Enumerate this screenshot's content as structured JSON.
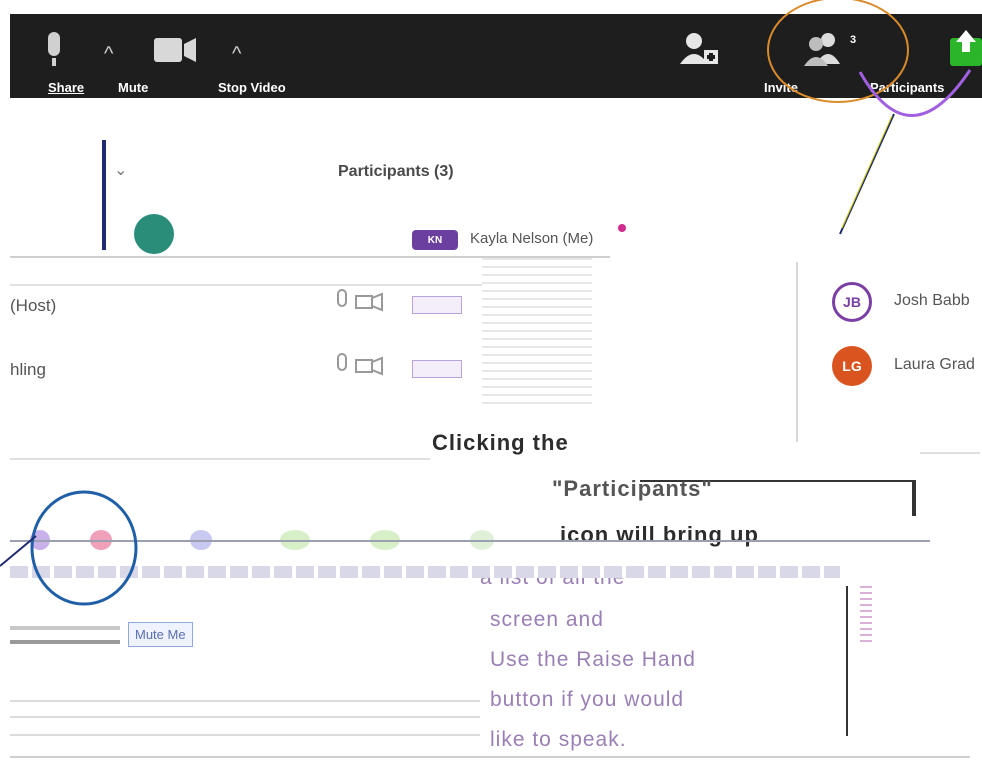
{
  "toolbar": {
    "share_label": "Share",
    "mute_label": "Mute",
    "stop_video_label": "Stop Video",
    "invite_label": "Invite",
    "participants_label": "Participants",
    "participants_count": "3"
  },
  "panel": {
    "title": "Participants (3)",
    "participants": [
      {
        "name": "Kayla Nelson (Me)",
        "initials": "KN",
        "color": "#6b3fa0"
      },
      {
        "name": "Josh Babb",
        "initials": "JB",
        "color": "#7a3fa3"
      },
      {
        "name": "Laura Grad",
        "initials": "LG",
        "color": "#d9541f"
      }
    ],
    "host_fragment": "(Host)",
    "row3_fragment": "hling",
    "mute_me_label": "Mute Me"
  },
  "annotation": {
    "line1": "Clicking the",
    "line2": "\"Participants\"",
    "line3": "icon will bring up",
    "line4": "a list of all the",
    "line5": "screen and",
    "line6": "Use the Raise Hand",
    "line7": "button if you would",
    "line8": "like to speak."
  },
  "colors": {
    "toolbar_bg": "#1e1e1e",
    "circle_orange": "#d98b2b",
    "circle_purple": "#a060e0",
    "annot_circle": "#1f5fa8",
    "share_green": "#2bb52b"
  },
  "icons": [
    "microphone-icon",
    "camera-icon",
    "invite-icon",
    "participants-icon",
    "share-screen-icon",
    "chevron-up-icon"
  ]
}
